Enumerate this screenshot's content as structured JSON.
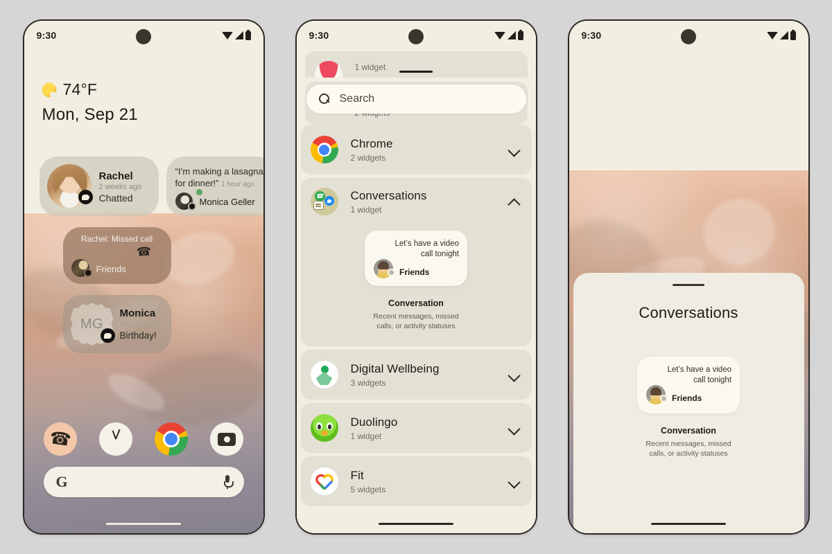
{
  "status_bar": {
    "time": "9:30",
    "icons": [
      "wifi-icon",
      "signal-icon",
      "battery-icon"
    ]
  },
  "home_screen": {
    "weather": {
      "temperature": "74°F",
      "icon": "sun-icon"
    },
    "date": "Mon, Sep 21",
    "conversation_widgets": [
      {
        "name": "Rachel",
        "timestamp": "2 weeks ago",
        "status": "Chatted",
        "badge": "message-icon"
      },
      {
        "quote": "“I’m making a lasagna for dinner!”",
        "timestamp": "1 hour ago",
        "name": "Monica Geller",
        "badge": "message-icon"
      },
      {
        "title": "Rachel: Missed call",
        "name": "Friends",
        "icon": "missed-call-icon"
      },
      {
        "name": "Monica",
        "initials": "MG",
        "status_line1": "It's Monica's",
        "status_line2": "Birthday!",
        "badge": "message-icon"
      }
    ],
    "dock": [
      {
        "label": "Phone",
        "icon": "phone-icon"
      },
      {
        "label": "Clock",
        "icon": "clock-icon"
      },
      {
        "label": "Chrome",
        "icon": "chrome-icon"
      },
      {
        "label": "Camera",
        "icon": "camera-icon"
      }
    ],
    "search_pill": {
      "logo": "G",
      "mic": "microphone-icon"
    }
  },
  "widget_picker": {
    "search": {
      "placeholder": "Search",
      "icon": "search-icon"
    },
    "partial_row_top": {
      "count": "1 widget"
    },
    "partial_row_second": {
      "count": "2 widgets"
    },
    "rows": [
      {
        "name": "Chrome",
        "count": "2 widgets",
        "chevron": "chevron-down-icon",
        "expanded": false
      },
      {
        "name": "Conversations",
        "count": "1 widget",
        "chevron": "chevron-up-icon",
        "expanded": true
      },
      {
        "name": "Digital Wellbeing",
        "count": "3 widgets",
        "chevron": "chevron-down-icon",
        "expanded": false
      },
      {
        "name": "Duolingo",
        "count": "1 widget",
        "chevron": "chevron-down-icon",
        "expanded": false
      },
      {
        "name": "Fit",
        "count": "5 widgets",
        "chevron": "chevron-down-icon",
        "expanded": false
      }
    ],
    "preview": {
      "message_line1": "Let’s have a video",
      "message_line2": "call tonight",
      "contact": "Friends",
      "title": "Conversation",
      "description_line1": "Recent messages, missed",
      "description_line2": "calls, or activity statuses"
    }
  },
  "bottom_sheet": {
    "title": "Conversations",
    "preview": {
      "message_line1": "Let’s have a video",
      "message_line2": "call tonight",
      "contact": "Friends",
      "title": "Conversation",
      "description_line1": "Recent messages, missed",
      "description_line2": "calls, or activity statuses"
    }
  },
  "colors": {
    "background": "#d6d6d6",
    "screen_bg": "#f2efe2",
    "row_bg": "#e3e0d4",
    "text_primary": "#1d1b16",
    "text_secondary": "#6f6c62",
    "missed_call_card": "#96755e"
  }
}
